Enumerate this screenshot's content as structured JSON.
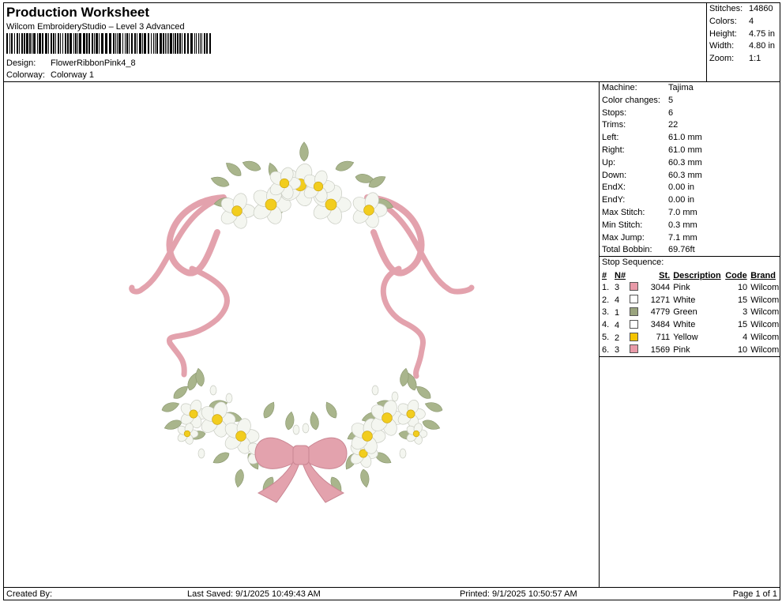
{
  "header": {
    "title": "Production Worksheet",
    "software": "Wilcom EmbroideryStudio – Level 3 Advanced",
    "design_label": "Design:",
    "design_value": "FlowerRibbonPink4_8",
    "colorway_label": "Colorway:",
    "colorway_value": "Colorway 1"
  },
  "summary": [
    {
      "label": "Stitches:",
      "value": "14860"
    },
    {
      "label": "Colors:",
      "value": "4"
    },
    {
      "label": "Height:",
      "value": "4.75 in"
    },
    {
      "label": "Width:",
      "value": "4.80 in"
    },
    {
      "label": "Zoom:",
      "value": "1:1"
    }
  ],
  "machine_info": [
    {
      "label": "Machine:",
      "value": "Tajima"
    },
    {
      "label": "Color changes:",
      "value": "5"
    },
    {
      "label": "Stops:",
      "value": "6"
    },
    {
      "label": "Trims:",
      "value": "22"
    },
    {
      "label": "Left:",
      "value": "61.0 mm"
    },
    {
      "label": "Right:",
      "value": "61.0 mm"
    },
    {
      "label": "Up:",
      "value": "60.3 mm"
    },
    {
      "label": "Down:",
      "value": "60.3 mm"
    },
    {
      "label": "EndX:",
      "value": "0.00 in"
    },
    {
      "label": "EndY:",
      "value": "0.00 in"
    },
    {
      "label": "Max Stitch:",
      "value": "7.0 mm"
    },
    {
      "label": "Min Stitch:",
      "value": "0.3 mm"
    },
    {
      "label": "Max Jump:",
      "value": "7.1 mm"
    },
    {
      "label": "Total Bobbin:",
      "value": "69.76ft"
    }
  ],
  "stop_sequence": {
    "title": "Stop Sequence:",
    "headers": [
      "#",
      "N#",
      "St.",
      "Description",
      "Code",
      "Brand"
    ],
    "rows": [
      {
        "idx": "1.",
        "n": "3",
        "swatch": "#e89aa8",
        "st": "3044",
        "desc": "Pink",
        "code": "10",
        "brand": "Wilcom"
      },
      {
        "idx": "2.",
        "n": "4",
        "swatch": "#ffffff",
        "st": "1271",
        "desc": "White",
        "code": "15",
        "brand": "Wilcom"
      },
      {
        "idx": "3.",
        "n": "1",
        "swatch": "#9aa47e",
        "st": "4779",
        "desc": "Green",
        "code": "3",
        "brand": "Wilcom"
      },
      {
        "idx": "4.",
        "n": "4",
        "swatch": "#ffffff",
        "st": "3484",
        "desc": "White",
        "code": "15",
        "brand": "Wilcom"
      },
      {
        "idx": "5.",
        "n": "2",
        "swatch": "#f5c400",
        "st": "711",
        "desc": "Yellow",
        "code": "4",
        "brand": "Wilcom"
      },
      {
        "idx": "6.",
        "n": "3",
        "swatch": "#e89aa8",
        "st": "1569",
        "desc": "Pink",
        "code": "10",
        "brand": "Wilcom"
      }
    ]
  },
  "footer": {
    "created_by": "Created By:",
    "last_saved": "Last Saved: 9/1/2025 10:49:43 AM",
    "printed": "Printed: 9/1/2025 10:50:57 AM",
    "page": "Page 1 of 1"
  },
  "colors": {
    "ribbon": "#e3a2ad",
    "ribbon_dark": "#c98592",
    "leaf": "#a9b58c",
    "leaf_dark": "#8b9870",
    "petal": "#f4f6f0",
    "center": "#f2cd1e"
  }
}
